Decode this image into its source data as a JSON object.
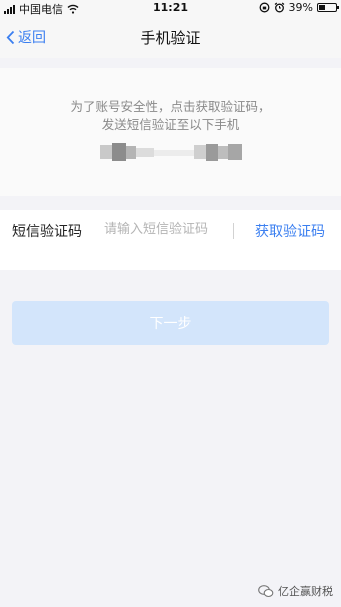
{
  "status_bar": {
    "carrier": "中国电信",
    "time": "11:21",
    "battery": "39%",
    "battery_level": 0.39
  },
  "nav": {
    "back_label": "返回",
    "title": "手机验证"
  },
  "info": {
    "line1": "为了账号安全性，点击获取验证码，",
    "line2": "发送短信验证至以下手机"
  },
  "code_form": {
    "label": "短信验证码",
    "placeholder": "请输入短信验证码",
    "get_code_label": "获取验证码"
  },
  "next_button": {
    "label": "下一步"
  },
  "watermark": {
    "text": "亿企赢财税"
  },
  "colors": {
    "accent": "#3b7ff0",
    "button_disabled": "#d3e5fb",
    "background": "#f3f3f7"
  }
}
